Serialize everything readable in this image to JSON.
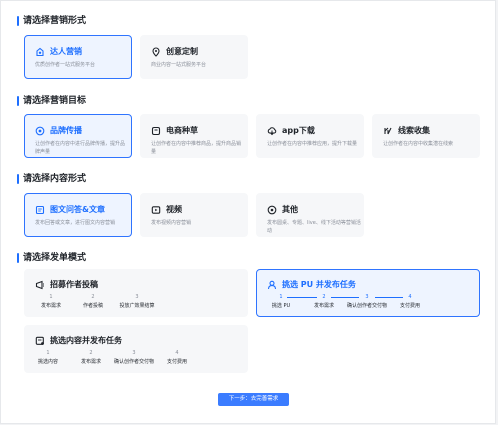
{
  "sections": {
    "form": {
      "title": "请选择营销形式",
      "cards": [
        {
          "icon": "star-badge-icon",
          "name": "达人营销",
          "desc": "优质创作者一站式服务平台"
        },
        {
          "icon": "location-pin-icon",
          "name": "创意定制",
          "desc": "商业内容一站式服务平台"
        }
      ]
    },
    "goal": {
      "title": "请选择营销目标",
      "cards": [
        {
          "icon": "brand-icon",
          "name": "品牌传播",
          "desc": "让创作者在内容中进行品牌传播，提升品牌声量"
        },
        {
          "icon": "shop-icon",
          "name": "电商种草",
          "desc": "让创作者在内容中推荐商品，提升商品销量"
        },
        {
          "icon": "cloud-download-icon",
          "name": "app下载",
          "desc": "让创作者在内容中推荐应用，提升下载量"
        },
        {
          "icon": "leads-icon",
          "name": "线索收集",
          "desc": "让创作者在内容中收集潜在线索"
        }
      ]
    },
    "content": {
      "title": "请选择内容形式",
      "cards": [
        {
          "icon": "article-icon",
          "name": "图文问答&文章",
          "desc": "发布回答或文章，进行图文内容营销"
        },
        {
          "icon": "video-icon",
          "name": "视频",
          "desc": "发布视频内容营销"
        },
        {
          "icon": "other-icon",
          "name": "其他",
          "desc": "发布圆桌、专题、live、线下活动等营销活动"
        }
      ]
    },
    "order": {
      "title": "请选择发单模式",
      "cards": [
        {
          "icon": "recruit-icon",
          "name": "招募作者投稿",
          "steps": [
            {
              "num": "1",
              "label": "发布需求"
            },
            {
              "num": "2",
              "label": "作者投稿"
            },
            {
              "num": "3",
              "label": "投放广效果结算"
            }
          ]
        },
        {
          "icon": "user-icon",
          "name": "挑选 PU 并发布任务",
          "steps": [
            {
              "num": "1",
              "label": "挑选 PU"
            },
            {
              "num": "2",
              "label": "发布需求"
            },
            {
              "num": "3",
              "label": "确认创作者交付物"
            },
            {
              "num": "4",
              "label": "支付费用"
            }
          ]
        },
        {
          "icon": "content-select-icon",
          "name": "挑选内容并发布任务",
          "steps": [
            {
              "num": "1",
              "label": "挑选内容"
            },
            {
              "num": "2",
              "label": "发布需求"
            },
            {
              "num": "3",
              "label": "确认创作者交付物"
            },
            {
              "num": "4",
              "label": "支付费用"
            }
          ]
        }
      ]
    }
  },
  "next_button": "下一步：去完善需求",
  "colors": {
    "accent": "#1e6fff",
    "card_bg": "#f6f7f9",
    "selected_bg": "#eef4ff"
  }
}
